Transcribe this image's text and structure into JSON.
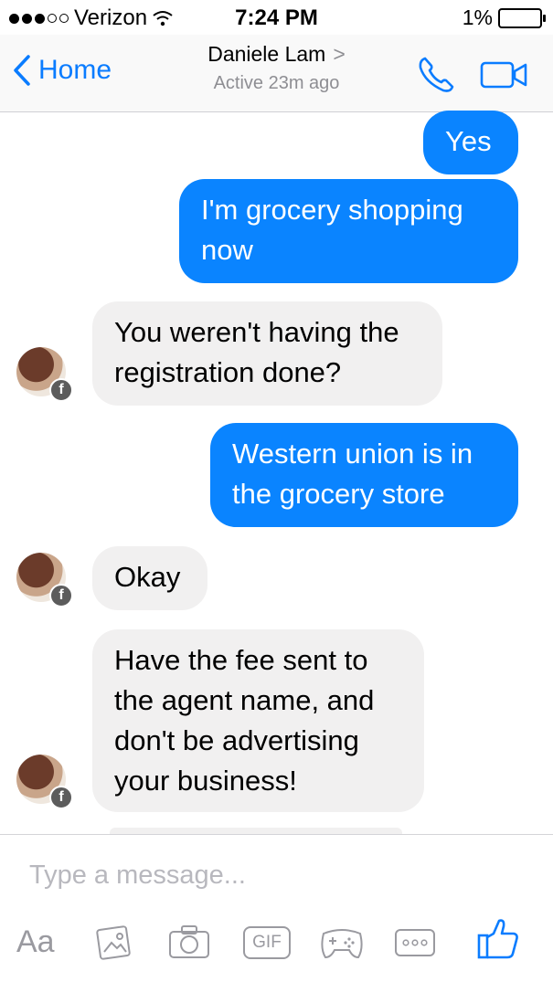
{
  "status": {
    "carrier": "Verizon",
    "time": "7:24 PM",
    "battery": "1%"
  },
  "nav": {
    "back_label": "Home",
    "title": "Daniele Lam",
    "subtitle": "Active 23m ago"
  },
  "messages": [
    {
      "from": "me",
      "text": "Yes"
    },
    {
      "from": "me",
      "text": "I'm grocery shopping now"
    },
    {
      "from": "them",
      "text": "You weren't having the registration done?"
    },
    {
      "from": "me",
      "text": "Western union is in the grocery store"
    },
    {
      "from": "them",
      "text": "Okay"
    },
    {
      "from": "them",
      "text": "Have the fee sent to the agent name, and don't be advertising your business!"
    }
  ],
  "composer": {
    "placeholder": "Type a message...",
    "aa_label": "Aa",
    "gif_label": "GIF"
  },
  "colors": {
    "accent": "#0a84ff",
    "incoming": "#f1f0f0",
    "muted": "#8e8e93"
  }
}
